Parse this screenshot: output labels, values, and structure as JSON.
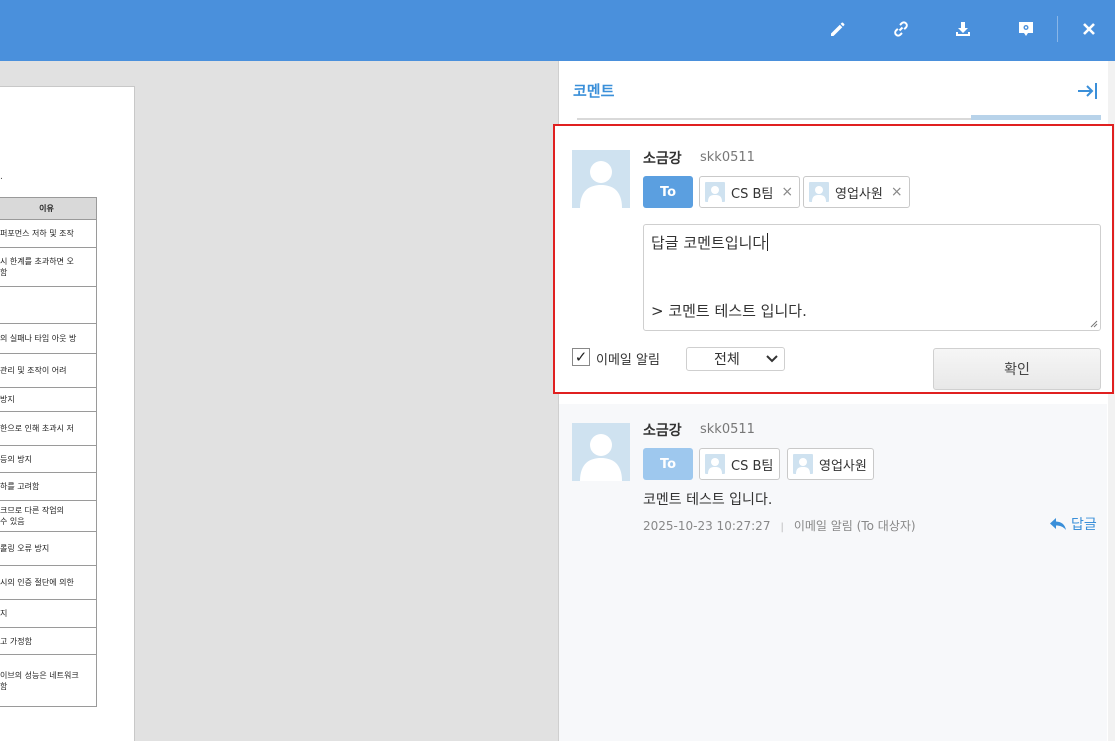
{
  "toolbar": {
    "icons": [
      "pencil-icon",
      "link-icon",
      "download-icon",
      "comment-settings-icon",
      "close-icon"
    ]
  },
  "document": {
    "table_header": "이유",
    "rows": [
      "퍼포먼스 저하 및 조작",
      "시 한계를 초과하면 오\n함",
      "",
      "의 실패나 타임 아웃 방",
      "관리 및 조작이 어려",
      "방지",
      "한으로 인해 초과시 저",
      "등의 방지",
      "하를 고려함",
      "크므로 다른 작업의\n수 있음",
      "롤링 오류 방지",
      "시의 인증 절단에 의한",
      "지",
      "고 가정함",
      "이브의 성능은 네트워크\n함"
    ]
  },
  "panel": {
    "title": "코멘트",
    "reply_form": {
      "author": "소금강",
      "user_id": "skk0511",
      "to_label": "To",
      "recipients": [
        "CS B팀",
        "영업사원"
      ],
      "text_line1": "답글 코멘트입니다",
      "text_quote": "> 코멘트 테스트 입니다.",
      "email_checked_mark": "✓",
      "email_label": "이메일 알림",
      "scope_select": "전체",
      "confirm_label": "확인"
    },
    "comment": {
      "author": "소금강",
      "user_id": "skk0511",
      "to_label": "To",
      "recipients": [
        "CS B팀",
        "영업사원"
      ],
      "text": "코멘트 테스트 입니다.",
      "timestamp": "2025-10-23 10:27:27",
      "meta_sep": "|",
      "email_info": "이메일 알림 (To 대상자)",
      "reply_label": "답글"
    },
    "colors": {
      "accent": "#3a8fd9",
      "topbar": "#4a90dc",
      "to_badge_active": "#5b9fe0",
      "to_badge_muted": "#9ec8ee",
      "highlight_border": "#e02020"
    }
  }
}
